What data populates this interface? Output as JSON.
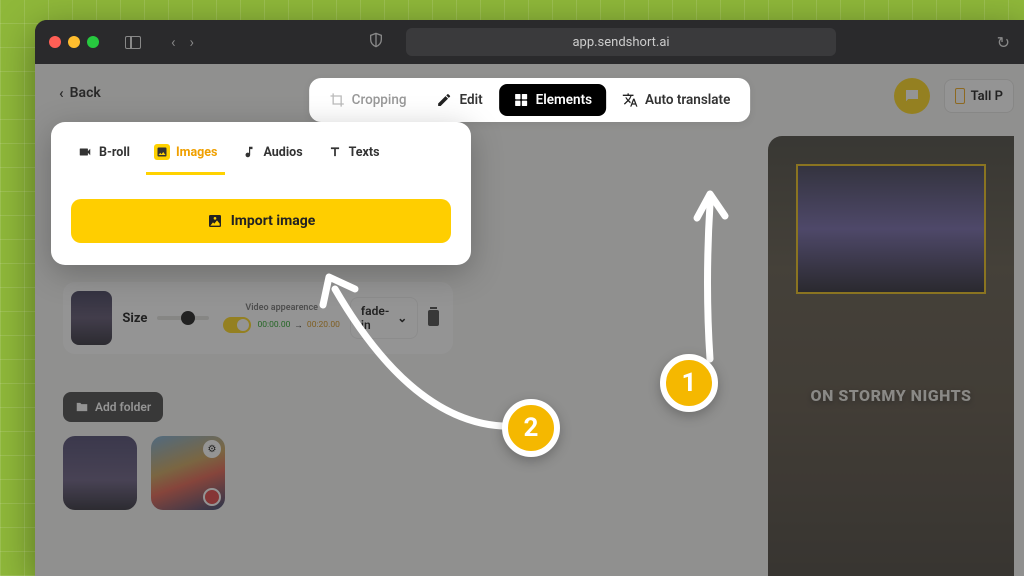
{
  "browser": {
    "url": "app.sendshort.ai"
  },
  "back": "Back",
  "toolbar": {
    "cropping": "Cropping",
    "edit": "Edit",
    "elements": "Elements",
    "auto_translate": "Auto translate"
  },
  "format_label": "Tall P",
  "panel": {
    "tabs": {
      "broll": "B-roll",
      "images": "Images",
      "audios": "Audios",
      "texts": "Texts"
    },
    "import_label": "Import image"
  },
  "media_row": {
    "size_label": "Size",
    "appearance_label": "Video appearence",
    "time_start": "00:00.00",
    "time_end": "00:20.00",
    "effect": "fade-in"
  },
  "add_folder": "Add folder",
  "preview": {
    "caption": "ON STORMY NIGHTS"
  },
  "steps": {
    "one": "1",
    "two": "2"
  }
}
